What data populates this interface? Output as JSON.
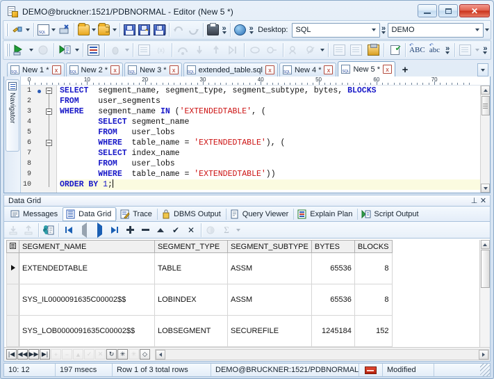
{
  "window": {
    "title": "DEMO@bruckner:1521/PDBNORMAL - Editor (New 5 *)",
    "icon": "editor-document-icon",
    "minimize_label": "",
    "maximize_label": "",
    "close_label": "✕"
  },
  "toolbar1": {
    "buttons": [
      {
        "name": "new-connection",
        "icon": "plug-icon",
        "enabled": true
      },
      {
        "name": "new-sql-window",
        "icon": "sql-document-icon",
        "enabled": true
      },
      {
        "name": "disconnect",
        "icon": "disconnect-icon",
        "enabled": true
      },
      {
        "name": "open-file",
        "icon": "folder-open-icon",
        "enabled": true
      },
      {
        "name": "open-recent",
        "icon": "folder-recent-icon",
        "enabled": true
      },
      {
        "name": "save",
        "icon": "save-icon",
        "enabled": true
      },
      {
        "name": "save-as",
        "icon": "save-as-icon",
        "enabled": true
      },
      {
        "name": "save-all",
        "icon": "save-all-icon",
        "enabled": true
      },
      {
        "name": "undo",
        "icon": "undo-icon",
        "enabled": false
      },
      {
        "name": "redo",
        "icon": "redo-icon",
        "enabled": false
      },
      {
        "name": "print",
        "icon": "print-icon",
        "enabled": true
      },
      {
        "name": "more-1",
        "icon": "chevron-double-icon",
        "enabled": true
      }
    ],
    "desktop_label": "Desktop:",
    "desktop_value": "SQL",
    "connection_value": "DEMO"
  },
  "toolbar2": {
    "buttons": [
      {
        "name": "execute-statement",
        "icon": "run-green-icon",
        "enabled": true
      },
      {
        "name": "execute-stop",
        "icon": "stop-icon",
        "enabled": false
      },
      {
        "name": "execute-script",
        "icon": "run-script-icon",
        "enabled": true
      },
      {
        "name": "explain-plan",
        "icon": "explain-plan-icon",
        "enabled": true
      },
      {
        "name": "debug",
        "icon": "debug-icon",
        "enabled": false
      },
      {
        "name": "compile-plsql",
        "icon": "plsql-icon",
        "enabled": false
      },
      {
        "name": "variables",
        "icon": "variables-icon",
        "enabled": false
      },
      {
        "name": "step-over",
        "icon": "step-over-icon",
        "enabled": false
      },
      {
        "name": "step-into",
        "icon": "step-into-icon",
        "enabled": false
      },
      {
        "name": "step-out",
        "icon": "step-out-icon",
        "enabled": false
      },
      {
        "name": "run-to-cursor",
        "icon": "run-to-cursor-icon",
        "enabled": false
      },
      {
        "name": "breakpoint",
        "icon": "breakpoint-icon",
        "enabled": false
      },
      {
        "name": "trace-toggle",
        "icon": "trace-icon",
        "enabled": false
      },
      {
        "name": "session-browser",
        "icon": "session-icon",
        "enabled": false
      },
      {
        "name": "cancel-query",
        "icon": "cancel-query-icon",
        "enabled": false
      },
      {
        "name": "format-sql",
        "icon": "format-sql-icon",
        "enabled": false
      },
      {
        "name": "paste-clipboard",
        "icon": "clipboard-icon",
        "enabled": true
      },
      {
        "name": "check-syntax",
        "icon": "checklist-icon",
        "enabled": true
      },
      {
        "name": "uppercase",
        "icon": "uppercase-abc-icon",
        "label": "ABC",
        "enabled": true
      },
      {
        "name": "lowercase",
        "icon": "lowercase-abc-icon",
        "label": "abc",
        "enabled": true
      },
      {
        "name": "more-2",
        "icon": "chevron-double-icon",
        "enabled": true
      },
      {
        "name": "templates",
        "icon": "template-icon",
        "enabled": false
      }
    ]
  },
  "tabs": {
    "items": [
      {
        "label": "New 1 *",
        "active": false
      },
      {
        "label": "New 2 *",
        "active": false
      },
      {
        "label": "New 3 *",
        "active": false
      },
      {
        "label": "extended_table.sql",
        "active": false
      },
      {
        "label": "New 4 *",
        "active": false
      },
      {
        "label": "New 5 *",
        "active": true
      }
    ],
    "close_glyph": "x",
    "add_tab_label": "+",
    "overflow_label": "▼"
  },
  "navigator": {
    "label": "Navigator"
  },
  "editor": {
    "ruler_marks": [
      "0",
      "10",
      "20",
      "30",
      "40",
      "50",
      "60",
      "70"
    ],
    "lines": [
      {
        "num": "1",
        "fold": true,
        "bookmark": true,
        "current": false,
        "tokens": [
          {
            "t": "SELECT",
            "c": "kw"
          },
          {
            "t": "  segment_name, segment_type, segment_subtype, bytes, ",
            "c": "pl"
          },
          {
            "t": "BLOCKS",
            "c": "kw"
          }
        ]
      },
      {
        "num": "2",
        "fold": false,
        "bookmark": false,
        "current": false,
        "tokens": [
          {
            "t": "FROM",
            "c": "kw"
          },
          {
            "t": "    user_segments",
            "c": "pl"
          }
        ]
      },
      {
        "num": "3",
        "fold": true,
        "bookmark": false,
        "current": false,
        "tokens": [
          {
            "t": "WHERE",
            "c": "kw"
          },
          {
            "t": "   segment_name ",
            "c": "pl"
          },
          {
            "t": "IN",
            "c": "kw"
          },
          {
            "t": " (",
            "c": "pl"
          },
          {
            "t": "'EXTENDEDTABLE'",
            "c": "str"
          },
          {
            "t": ", (",
            "c": "pl"
          }
        ]
      },
      {
        "num": "4",
        "fold": false,
        "bookmark": false,
        "current": false,
        "tokens": [
          {
            "t": "        ",
            "c": "pl"
          },
          {
            "t": "SELECT",
            "c": "kw"
          },
          {
            "t": " segment_name",
            "c": "pl"
          }
        ]
      },
      {
        "num": "5",
        "fold": false,
        "bookmark": false,
        "current": false,
        "tokens": [
          {
            "t": "        ",
            "c": "pl"
          },
          {
            "t": "FROM",
            "c": "kw"
          },
          {
            "t": "   user_lobs",
            "c": "pl"
          }
        ]
      },
      {
        "num": "6",
        "fold": true,
        "bookmark": false,
        "current": false,
        "tokens": [
          {
            "t": "        ",
            "c": "pl"
          },
          {
            "t": "WHERE",
            "c": "kw"
          },
          {
            "t": "  table_name = ",
            "c": "pl"
          },
          {
            "t": "'EXTENDEDTABLE'",
            "c": "str"
          },
          {
            "t": "), (",
            "c": "pl"
          }
        ]
      },
      {
        "num": "7",
        "fold": false,
        "bookmark": false,
        "current": false,
        "tokens": [
          {
            "t": "        ",
            "c": "pl"
          },
          {
            "t": "SELECT",
            "c": "kw"
          },
          {
            "t": " index_name",
            "c": "pl"
          }
        ]
      },
      {
        "num": "8",
        "fold": false,
        "bookmark": false,
        "current": false,
        "tokens": [
          {
            "t": "        ",
            "c": "pl"
          },
          {
            "t": "FROM",
            "c": "kw"
          },
          {
            "t": "   user_lobs",
            "c": "pl"
          }
        ]
      },
      {
        "num": "9",
        "fold": false,
        "bookmark": false,
        "current": false,
        "tokens": [
          {
            "t": "        ",
            "c": "pl"
          },
          {
            "t": "WHERE",
            "c": "kw"
          },
          {
            "t": "  table_name = ",
            "c": "pl"
          },
          {
            "t": "'EXTENDEDTABLE'",
            "c": "str"
          },
          {
            "t": "))",
            "c": "pl"
          }
        ]
      },
      {
        "num": "10",
        "fold": false,
        "bookmark": false,
        "current": true,
        "tokens": [
          {
            "t": "ORDER BY",
            "c": "kw"
          },
          {
            "t": " ",
            "c": "pl"
          },
          {
            "t": "1",
            "c": "num"
          },
          {
            "t": ";",
            "c": "pl"
          }
        ]
      }
    ]
  },
  "panel": {
    "title": "Data Grid",
    "pin_glyph": "⊥",
    "close_glyph": "✕",
    "tabs": [
      {
        "label": "Messages",
        "icon": "messages-icon",
        "active": false
      },
      {
        "label": "Data Grid",
        "icon": "data-grid-icon",
        "active": true
      },
      {
        "label": "Trace",
        "icon": "trace-icon",
        "active": false
      },
      {
        "label": "DBMS Output",
        "icon": "dbms-output-icon",
        "active": false
      },
      {
        "label": "Query Viewer",
        "icon": "query-viewer-icon",
        "active": false
      },
      {
        "label": "Explain Plan",
        "icon": "explain-plan-icon",
        "active": false
      },
      {
        "label": "Script Output",
        "icon": "script-output-icon",
        "active": false
      }
    ],
    "toolbar": [
      {
        "name": "import-data",
        "icon": "import-icon",
        "enabled": false
      },
      {
        "name": "export-data",
        "icon": "export-icon",
        "enabled": false
      },
      {
        "name": "copy-as-records",
        "icon": "copy-records-icon",
        "enabled": true
      },
      {
        "name": "first-record",
        "icon": "first-record-icon",
        "enabled": true
      },
      {
        "name": "previous-record",
        "icon": "previous-record-icon",
        "enabled": false
      },
      {
        "name": "next-record",
        "icon": "next-record-icon",
        "enabled": true
      },
      {
        "name": "last-record",
        "icon": "last-record-icon",
        "enabled": true
      },
      {
        "name": "insert-record",
        "icon": "plus-icon",
        "enabled": true
      },
      {
        "name": "delete-record",
        "icon": "minus-icon",
        "enabled": true
      },
      {
        "name": "edit-record",
        "icon": "caret-up-icon",
        "enabled": true
      },
      {
        "name": "post-edit",
        "icon": "check-icon",
        "enabled": true
      },
      {
        "name": "cancel-edit",
        "icon": "x-icon",
        "enabled": true
      },
      {
        "name": "single-record-view",
        "icon": "record-view-icon",
        "enabled": false
      },
      {
        "name": "aggregate-sum",
        "icon": "sigma-icon",
        "enabled": false
      }
    ],
    "navbar_buttons": [
      {
        "name": "grid-first",
        "glyph": "|◀",
        "enabled": true
      },
      {
        "name": "grid-prior-page",
        "glyph": "◀◀",
        "enabled": true
      },
      {
        "name": "grid-next-page",
        "glyph": "▶▶",
        "enabled": true
      },
      {
        "name": "grid-last",
        "glyph": "▶|",
        "enabled": true
      },
      {
        "name": "grid-insert",
        "glyph": "+",
        "enabled": false
      },
      {
        "name": "grid-delete",
        "glyph": "−",
        "enabled": false
      },
      {
        "name": "grid-edit",
        "glyph": "▲",
        "enabled": false
      },
      {
        "name": "grid-post",
        "glyph": "✓",
        "enabled": false
      },
      {
        "name": "grid-cancel",
        "glyph": "✕",
        "enabled": false
      },
      {
        "name": "grid-refresh",
        "glyph": "↻",
        "enabled": true
      },
      {
        "name": "grid-asterisk",
        "glyph": "✳",
        "enabled": true
      },
      {
        "name": "grid-asterisk-2",
        "glyph": "✳",
        "enabled": false
      },
      {
        "name": "grid-clear-filter",
        "glyph": "◇",
        "enabled": true
      }
    ]
  },
  "grid": {
    "columns": [
      "SEGMENT_NAME",
      "SEGMENT_TYPE",
      "SEGMENT_SUBTYPE",
      "BYTES",
      "BLOCKS"
    ],
    "rows": [
      {
        "selected": true,
        "cells": [
          "EXTENDEDTABLE",
          "TABLE",
          "ASSM",
          "65536",
          "8"
        ]
      },
      {
        "selected": false,
        "cells": [
          "SYS_IL0000091635C00002$$",
          "LOBINDEX",
          "ASSM",
          "65536",
          "8"
        ]
      },
      {
        "selected": false,
        "cells": [
          "SYS_LOB0000091635C00002$$",
          "LOBSEGMENT",
          "SECUREFILE",
          "1245184",
          "152"
        ]
      }
    ]
  },
  "statusbar": {
    "cursor_position": "10: 12",
    "elapsed": "197 msecs",
    "row_info": "Row 1 of 3 total rows",
    "connection": "DEMO@BRUCKNER:1521/PDBNORMAL",
    "modified": "Modified"
  }
}
